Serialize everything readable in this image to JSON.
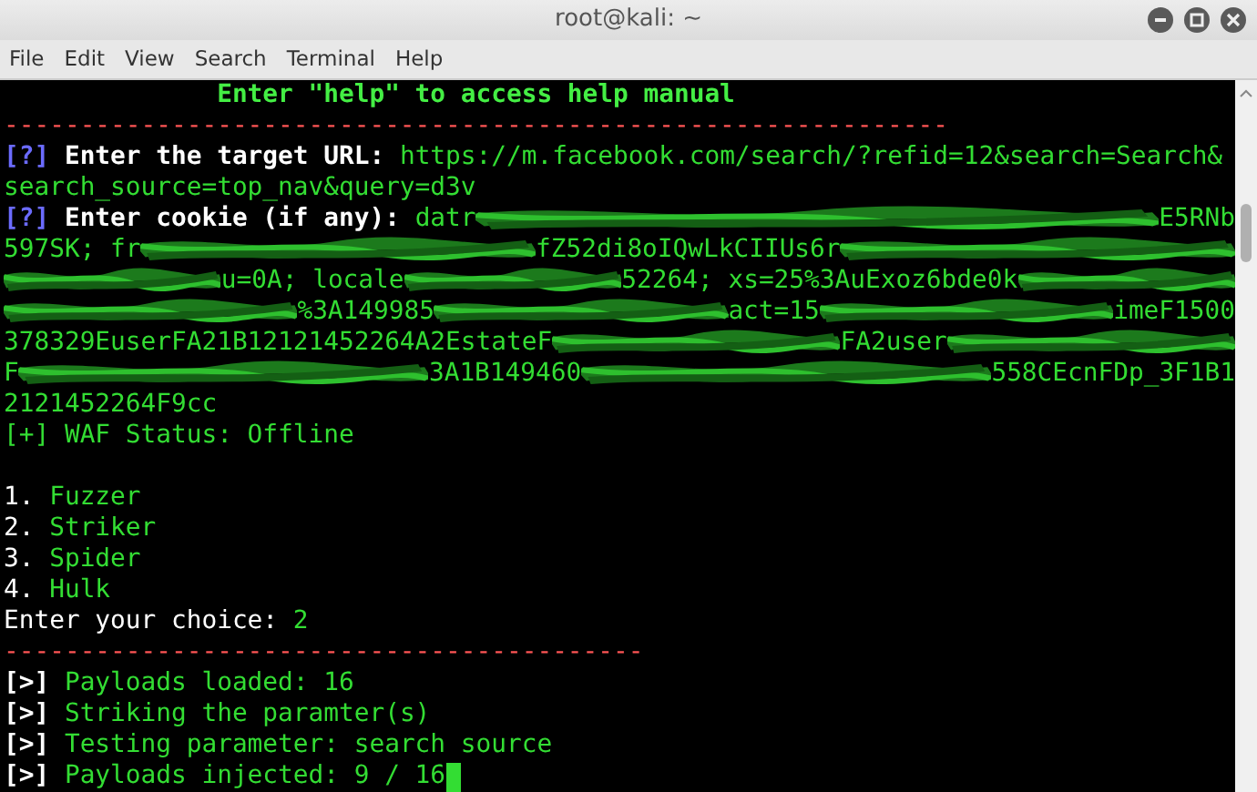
{
  "window": {
    "title": "root@kali: ~"
  },
  "menu": [
    "File",
    "Edit",
    "View",
    "Search",
    "Terminal",
    "Help"
  ],
  "terminal": {
    "lines": [
      {
        "kind": "text",
        "segments": [
          {
            "kind": "text",
            "text": "              Enter \"help\" to access help manual",
            "color": "#44ee44",
            "bold": true
          }
        ]
      },
      {
        "kind": "text",
        "segments": [
          {
            "kind": "text",
            "text": "--------------------------------------------------------------",
            "color": "#ff5555",
            "bold": false
          }
        ]
      },
      {
        "kind": "text",
        "segments": [
          {
            "kind": "text",
            "text": "[?]",
            "color": "#6b6bff",
            "bold": true
          },
          {
            "kind": "text",
            "text": " Enter the target URL: ",
            "color": "#ffffff",
            "bold": true
          },
          {
            "kind": "text",
            "text": "https://m.facebook.com/search/?refid=12&search=Search&",
            "color": "#33dd33",
            "bold": false
          }
        ]
      },
      {
        "kind": "text",
        "segments": [
          {
            "kind": "text",
            "text": "search_source=top_nav&query=d3v",
            "color": "#33dd33",
            "bold": false
          }
        ]
      },
      {
        "kind": "text",
        "segments": [
          {
            "kind": "text",
            "text": "[?]",
            "color": "#6b6bff",
            "bold": true
          },
          {
            "kind": "text",
            "text": " Enter cookie (if any): ",
            "color": "#ffffff",
            "bold": true
          },
          {
            "kind": "text",
            "text": "datr",
            "color": "#33dd33",
            "bold": false
          },
          {
            "kind": "redacted"
          },
          {
            "kind": "text",
            "text": "E5RNb",
            "color": "#33dd33",
            "bold": false
          }
        ]
      },
      {
        "kind": "text",
        "segments": [
          {
            "kind": "text",
            "text": "597SK; fr",
            "color": "#33dd33",
            "bold": false
          },
          {
            "kind": "redacted"
          },
          {
            "kind": "text",
            "text": "fZ52di8oIQwLkCIIUs6r",
            "color": "#33dd33",
            "bold": false
          },
          {
            "kind": "redacted"
          }
        ]
      },
      {
        "kind": "text",
        "segments": [
          {
            "kind": "redacted"
          },
          {
            "kind": "text",
            "text": "u=0A; locale",
            "color": "#33dd33",
            "bold": false
          },
          {
            "kind": "redacted"
          },
          {
            "kind": "text",
            "text": "52264; xs=25%3AuExoz6bde0k",
            "color": "#33dd33",
            "bold": false
          },
          {
            "kind": "redacted"
          }
        ]
      },
      {
        "kind": "text",
        "segments": [
          {
            "kind": "redacted"
          },
          {
            "kind": "text",
            "text": "%3A149985",
            "color": "#33dd33",
            "bold": false
          },
          {
            "kind": "redacted"
          },
          {
            "kind": "text",
            "text": "act=15",
            "color": "#33dd33",
            "bold": false
          },
          {
            "kind": "redacted"
          },
          {
            "kind": "text",
            "text": "imeF1500",
            "color": "#33dd33",
            "bold": false
          }
        ]
      },
      {
        "kind": "text",
        "segments": [
          {
            "kind": "text",
            "text": "378329EuserFA21B12121452264A2EstateF",
            "color": "#33dd33",
            "bold": false
          },
          {
            "kind": "redacted"
          },
          {
            "kind": "text",
            "text": "FA2user",
            "color": "#33dd33",
            "bold": false
          },
          {
            "kind": "redacted"
          }
        ]
      },
      {
        "kind": "text",
        "segments": [
          {
            "kind": "text",
            "text": "F",
            "color": "#33dd33",
            "bold": false
          },
          {
            "kind": "redacted"
          },
          {
            "kind": "text",
            "text": "3A1B149460",
            "color": "#33dd33",
            "bold": false
          },
          {
            "kind": "redacted"
          },
          {
            "kind": "text",
            "text": "558CEcnFDp_3F1B1",
            "color": "#33dd33",
            "bold": false
          }
        ]
      },
      {
        "kind": "text",
        "segments": [
          {
            "kind": "text",
            "text": "2121452264F9cc",
            "color": "#33dd33",
            "bold": false
          }
        ]
      },
      {
        "kind": "text",
        "segments": [
          {
            "kind": "text",
            "text": "[+] WAF Status: Offline",
            "color": "#33dd33",
            "bold": false
          }
        ]
      },
      {
        "kind": "blank"
      },
      {
        "kind": "text",
        "segments": [
          {
            "kind": "text",
            "text": "1. ",
            "color": "#ffffff",
            "bold": false
          },
          {
            "kind": "text",
            "text": "Fuzzer",
            "color": "#33dd33",
            "bold": false
          }
        ]
      },
      {
        "kind": "text",
        "segments": [
          {
            "kind": "text",
            "text": "2. ",
            "color": "#ffffff",
            "bold": false
          },
          {
            "kind": "text",
            "text": "Striker",
            "color": "#33dd33",
            "bold": false
          }
        ]
      },
      {
        "kind": "text",
        "segments": [
          {
            "kind": "text",
            "text": "3. ",
            "color": "#ffffff",
            "bold": false
          },
          {
            "kind": "text",
            "text": "Spider",
            "color": "#33dd33",
            "bold": false
          }
        ]
      },
      {
        "kind": "text",
        "segments": [
          {
            "kind": "text",
            "text": "4. ",
            "color": "#ffffff",
            "bold": false
          },
          {
            "kind": "text",
            "text": "Hulk",
            "color": "#33dd33",
            "bold": false
          }
        ]
      },
      {
        "kind": "text",
        "segments": [
          {
            "kind": "text",
            "text": "Enter your choice: ",
            "color": "#ffffff",
            "bold": false
          },
          {
            "kind": "text",
            "text": "2",
            "color": "#33dd33",
            "bold": false
          }
        ]
      },
      {
        "kind": "text",
        "segments": [
          {
            "kind": "text",
            "text": "------------------------------------------",
            "color": "#ff5555",
            "bold": false
          }
        ]
      },
      {
        "kind": "text",
        "segments": [
          {
            "kind": "text",
            "text": "[>]",
            "color": "#ffffff",
            "bold": true
          },
          {
            "kind": "text",
            "text": " Payloads loaded: 16",
            "color": "#33dd33",
            "bold": false
          }
        ]
      },
      {
        "kind": "text",
        "segments": [
          {
            "kind": "text",
            "text": "[>]",
            "color": "#ffffff",
            "bold": true
          },
          {
            "kind": "text",
            "text": " Striking the paramter(s)",
            "color": "#33dd33",
            "bold": false
          }
        ]
      },
      {
        "kind": "text",
        "segments": [
          {
            "kind": "text",
            "text": "[>]",
            "color": "#ffffff",
            "bold": true
          },
          {
            "kind": "text",
            "text": " Testing parameter: search source",
            "color": "#33dd33",
            "bold": false
          }
        ]
      },
      {
        "kind": "text",
        "segments": [
          {
            "kind": "text",
            "text": "[>]",
            "color": "#ffffff",
            "bold": true
          },
          {
            "kind": "text",
            "text": " Payloads injected: 9 / 16",
            "color": "#33dd33",
            "bold": false
          }
        ],
        "cursor": true
      }
    ]
  }
}
